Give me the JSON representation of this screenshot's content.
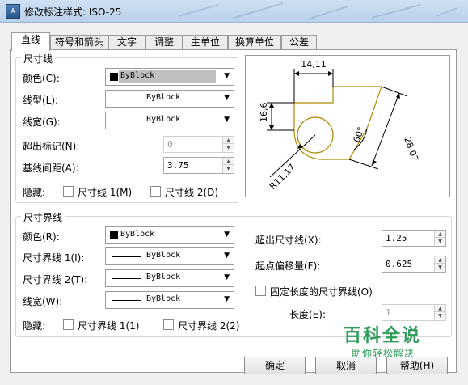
{
  "window": {
    "title": "修改标注样式: ISO-25"
  },
  "tabs": [
    "直线",
    "符号和箭头",
    "文字",
    "调整",
    "主单位",
    "换算单位",
    "公差"
  ],
  "dim_line": {
    "group_title": "尺寸线",
    "color_label": "颜色(C):",
    "color_value": "ByBlock",
    "linetype_label": "线型(L):",
    "linetype_value": "ByBlock",
    "lineweight_label": "线宽(G):",
    "lineweight_value": "ByBlock",
    "extend_ticks_label": "超出标记(N):",
    "extend_ticks_value": "0",
    "baseline_spacing_label": "基线间距(A):",
    "baseline_spacing_value": "3.75",
    "suppress_label": "隐藏:",
    "suppress_1_label": "尺寸线 1(M)",
    "suppress_2_label": "尺寸线 2(D)"
  },
  "ext_line": {
    "group_title": "尺寸界线",
    "color_label": "颜色(R):",
    "color_value": "ByBlock",
    "linetype1_label": "尺寸界线 1(I):",
    "linetype1_value": "ByBlock",
    "linetype2_label": "尺寸界线 2(T):",
    "linetype2_value": "ByBlock",
    "lineweight_label": "线宽(W):",
    "lineweight_value": "ByBlock",
    "suppress_label": "隐藏:",
    "suppress_1_label": "尺寸界线 1(1)",
    "suppress_2_label": "尺寸界线 2(2)",
    "extend_beyond_label": "超出尺寸线(X):",
    "extend_beyond_value": "1.25",
    "offset_label": "起点偏移量(F):",
    "offset_value": "0.625",
    "fixed_length_label": "固定长度的尺寸界线(O)",
    "length_label": "长度(E):",
    "length_value": "1"
  },
  "preview": {
    "dim_top": "14,11",
    "dim_left": "16,6",
    "dim_right": "28,07",
    "dim_angle": "60°",
    "dim_radius": "R11,17"
  },
  "buttons": {
    "ok": "确定",
    "cancel": "取消",
    "help": "帮助(H)"
  },
  "watermark": {
    "title": "百科全说",
    "subtitle": "助你轻松解决"
  },
  "colors": {
    "shape_outline": "#b08a00",
    "titlebar": "#bfd5ec",
    "watermark": "#2f9e5b"
  }
}
